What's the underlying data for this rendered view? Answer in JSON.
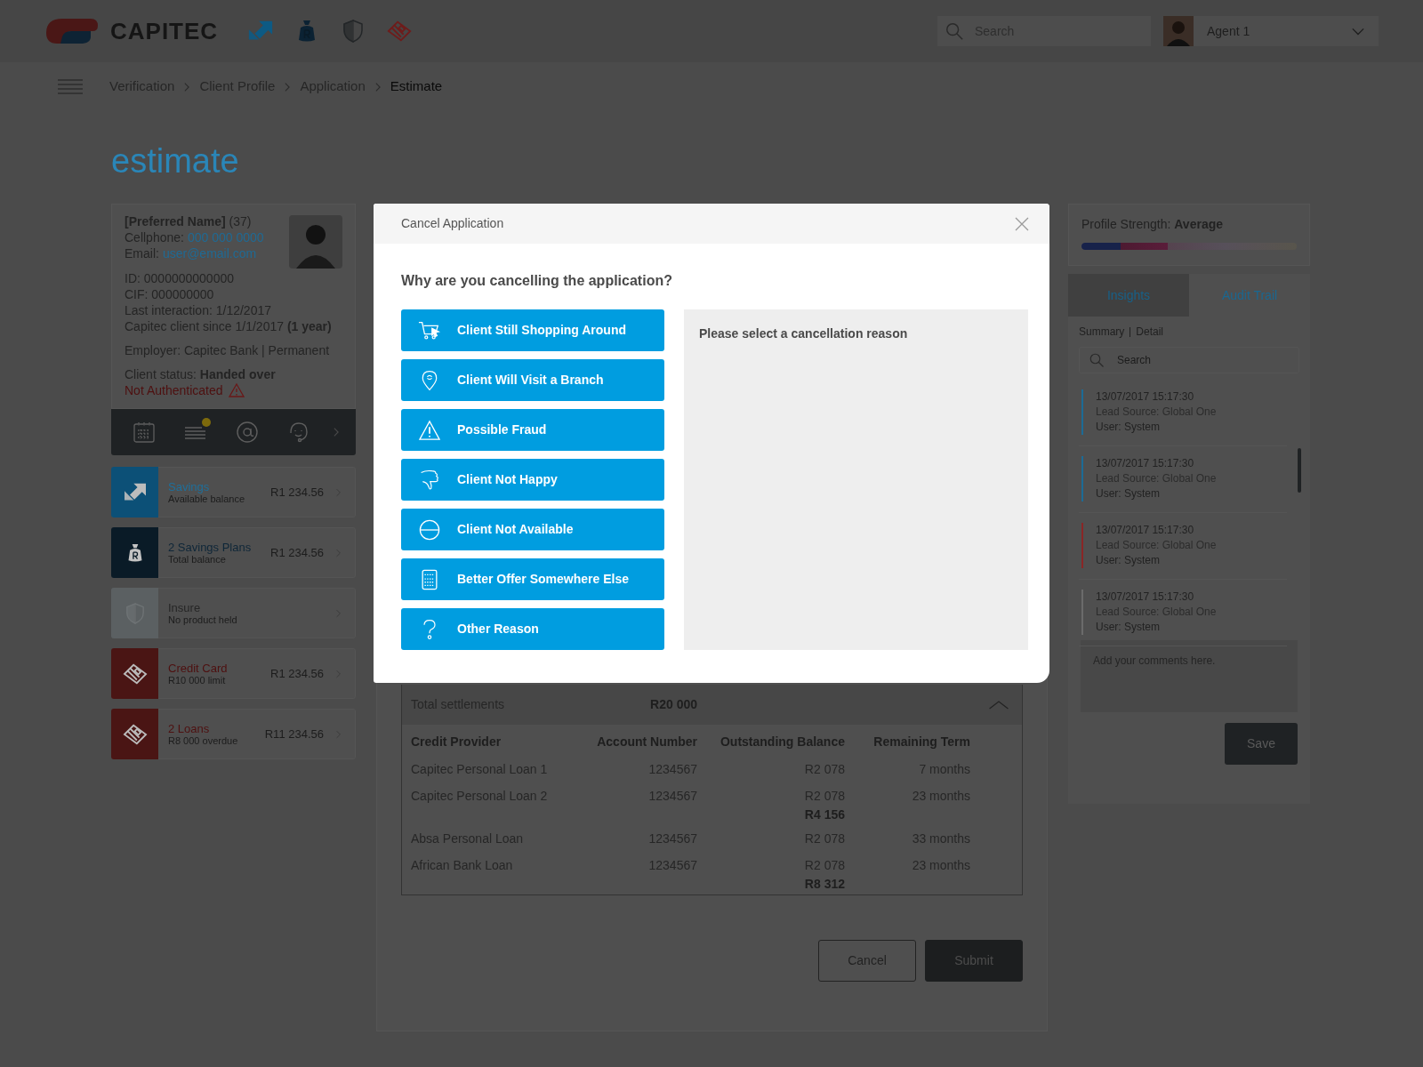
{
  "header": {
    "logo_text": "CAPITEC",
    "nav_icons": [
      {
        "kind": "savings"
      },
      {
        "kind": "plans"
      },
      {
        "kind": "insure"
      },
      {
        "kind": "credit"
      }
    ],
    "search": {
      "placeholder": "Search"
    },
    "agent": "Agent 1"
  },
  "breadcrumb": [
    {
      "label": "Verification",
      "current": false
    },
    {
      "label": "Client Profile",
      "current": false
    },
    {
      "label": "Application",
      "current": false
    },
    {
      "label": "Estimate",
      "current": true
    }
  ],
  "page_title": "estimate",
  "client": {
    "name_line": "**[Preferred Name]** (37)",
    "contacts": [
      {
        "label": "Cellphone:",
        "value": "000 000 0000"
      },
      {
        "label": "Email:",
        "value": "user@email.com"
      }
    ],
    "details": [
      "ID: 0000000000000",
      "CIF: 000000000",
      "Last interaction: 1/12/2017",
      "Capitec client since 1/1/2017 **(1 year)**"
    ],
    "employer": "Employer: Capitec Bank | Permanent",
    "status": "Client status: **Handed over**",
    "auth_warning": "Not Authenticated"
  },
  "client_actions": [
    {
      "kind": "calendar",
      "notification": false
    },
    {
      "kind": "notes",
      "notification": true
    },
    {
      "kind": "email",
      "notification": false
    },
    {
      "kind": "support",
      "notification": false
    }
  ],
  "products": [
    {
      "kind": "savings",
      "name": "Savings",
      "detail": "Available balance",
      "amount": "R1 234.56"
    },
    {
      "kind": "plans",
      "name": "2 Savings Plans",
      "detail": "Total balance",
      "amount": "R1 234.56"
    },
    {
      "kind": "insure",
      "name": "Insure",
      "detail": "No product held"
    },
    {
      "kind": "credit",
      "name": "Credit Card",
      "detail": "R10 000 limit",
      "amount": "R1 234.56"
    },
    {
      "kind": "loans",
      "name": "2 Loans",
      "detail": "R8 000 overdue",
      "amount": "R11 234.56"
    }
  ],
  "settlements": {
    "title": "Total settlements",
    "total": "R20 000",
    "expanded": true,
    "columns": [
      "Credit Provider",
      "Account Number",
      "Outstanding Balance",
      "Remaining Term"
    ],
    "rows": [
      {
        "kind": "loan",
        "cells": [
          "Capitec Personal Loan 1",
          "1234567",
          "R2 078",
          "7 months"
        ]
      },
      {
        "kind": "loan",
        "cells": [
          "Capitec Personal Loan 2",
          "1234567",
          "R2 078",
          "23 months"
        ]
      },
      {
        "kind": "subtotal",
        "cells": [
          "R4 156"
        ]
      },
      {
        "kind": "loan",
        "cells": [
          "Absa Personal Loan",
          "1234567",
          "R2 078",
          "33 months"
        ]
      },
      {
        "kind": "loan",
        "cells": [
          "African Bank Loan",
          "1234567",
          "R2 078",
          "23 months"
        ]
      },
      {
        "kind": "subtotal",
        "cells": [
          "R8 312"
        ]
      }
    ]
  },
  "form_buttons": [
    {
      "kind": "secondary",
      "label": "Cancel"
    },
    {
      "kind": "primary",
      "label": "Submit"
    }
  ],
  "profile_strength": {
    "label": "Profile Strength:",
    "value": "Average",
    "level": 0.4
  },
  "side_tabs": [
    {
      "label": "Insights",
      "selected": false
    },
    {
      "label": "Audit Trail",
      "selected": true
    }
  ],
  "views": [
    {
      "label": "Summary"
    },
    {
      "label": "Detail"
    }
  ],
  "audit_search": {
    "placeholder": "Search"
  },
  "audit_entries": [
    {
      "timestamp": "13/07/2017  15:17:30",
      "source": "Lead Source: Global One",
      "user": "User: System",
      "color": "#1c6b96"
    },
    {
      "timestamp": "13/07/2017  15:17:30",
      "source": "Lead Source: Global One",
      "user": "User: System",
      "color": "#1c6b96"
    },
    {
      "timestamp": "13/07/2017  15:17:30",
      "source": "Lead Source: Global One",
      "user": "User: System",
      "color": "#8a2626"
    },
    {
      "timestamp": "13/07/2017  15:17:30",
      "source": "Lead Source: Global One",
      "user": "User: System",
      "color": "#6b6b6b"
    }
  ],
  "comments": {
    "placeholder": "Add your comments here."
  },
  "save_button": "Save",
  "modal": {
    "title": "Cancel Application",
    "question": "Why are you cancelling the application?",
    "reasons": [
      {
        "kind": "cart",
        "label": "Client Still Shopping Around",
        "selected": false
      },
      {
        "kind": "pin",
        "label": "Client Will Visit a Branch",
        "selected": false
      },
      {
        "kind": "warning",
        "label": "Possible Fraud",
        "selected": false
      },
      {
        "kind": "thumbs-down",
        "label": "Client Not Happy",
        "selected": false
      },
      {
        "kind": "unavailable",
        "label": "Client Not Available",
        "selected": false
      },
      {
        "kind": "calculator",
        "label": "Better Offer Somewhere Else",
        "selected": false
      },
      {
        "kind": "question",
        "label": "Other Reason",
        "selected": false
      }
    ],
    "detail": {
      "placeholder": "Please select a cancellation reason"
    }
  }
}
